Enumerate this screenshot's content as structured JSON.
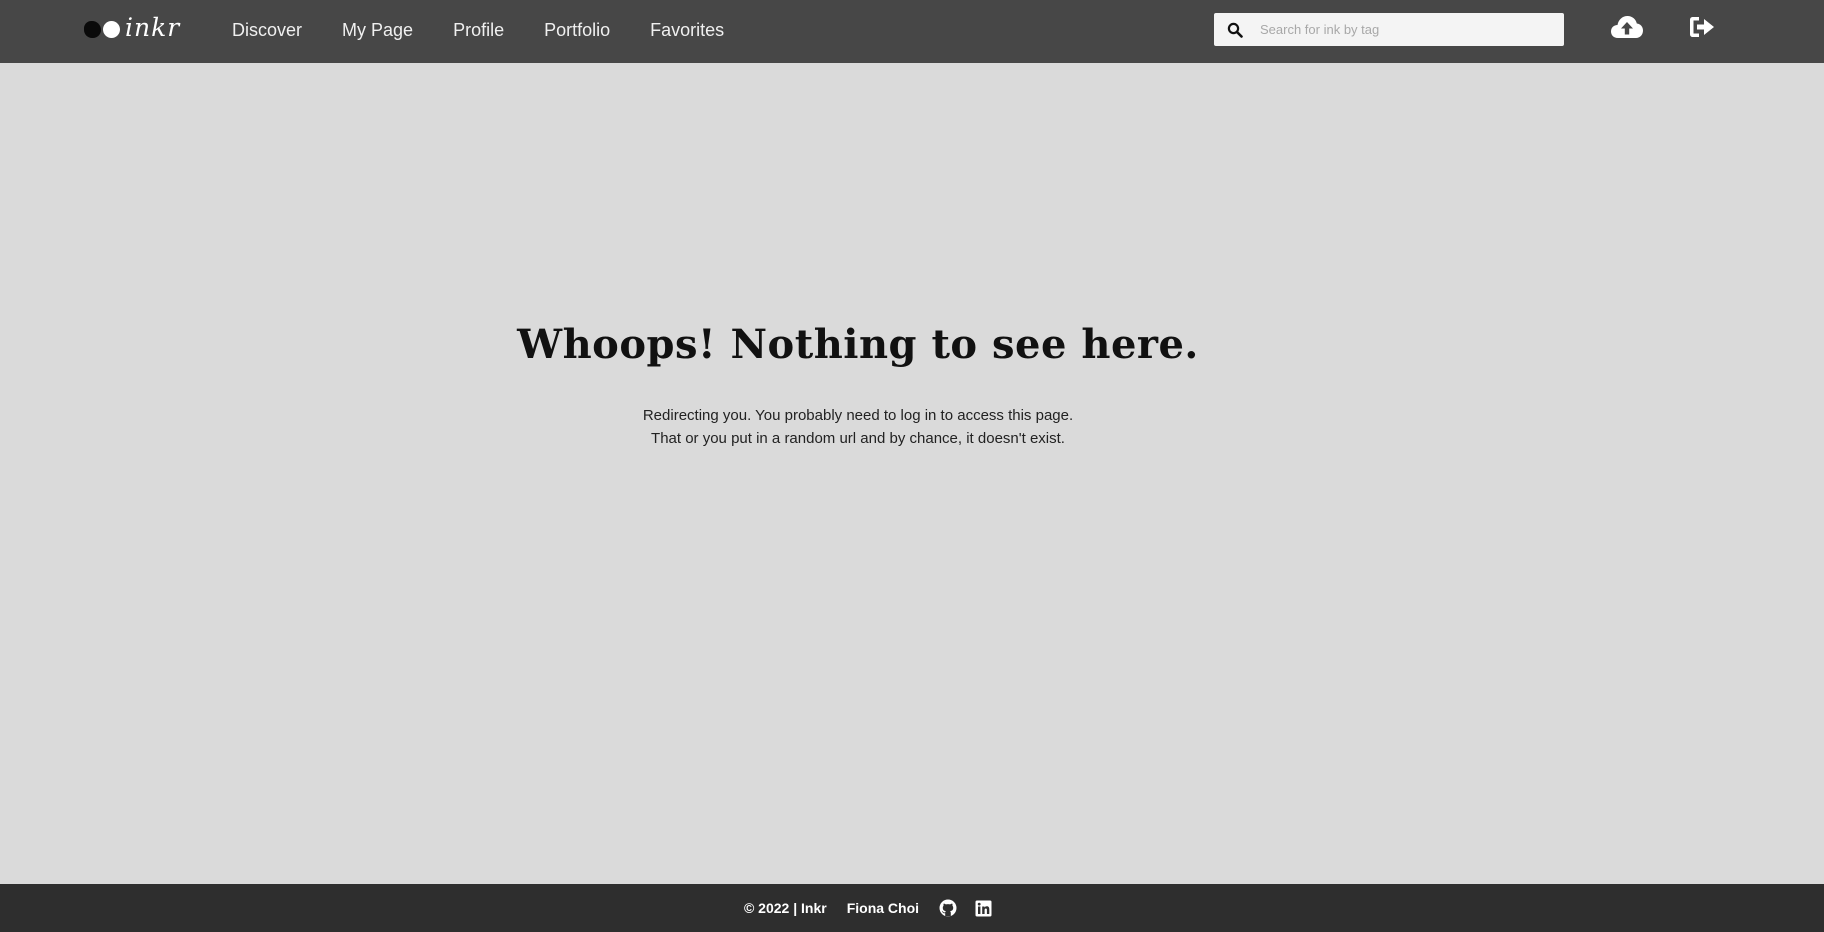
{
  "brand": {
    "name": "inkr"
  },
  "nav": {
    "items": [
      {
        "label": "Discover"
      },
      {
        "label": "My Page"
      },
      {
        "label": "Profile"
      },
      {
        "label": "Portfolio"
      },
      {
        "label": "Favorites"
      }
    ]
  },
  "search": {
    "placeholder": "Search for ink by tag",
    "value": ""
  },
  "actions": {
    "upload_icon": "cloud-upload-icon",
    "logout_icon": "sign-out-icon"
  },
  "main": {
    "headline": "Whoops! Nothing to see here.",
    "line1": "Redirecting you. You probably need to log in to access this page.",
    "line2": "That or you put in a random url and by chance, it doesn't exist."
  },
  "footer": {
    "copyright": "© 2022 | Inkr",
    "author": "Fiona Choi",
    "github_icon": "github-icon",
    "linkedin_icon": "linkedin-icon"
  },
  "colors": {
    "topbar": "#474747",
    "background": "#dadada",
    "footer": "#2e2e2e"
  }
}
